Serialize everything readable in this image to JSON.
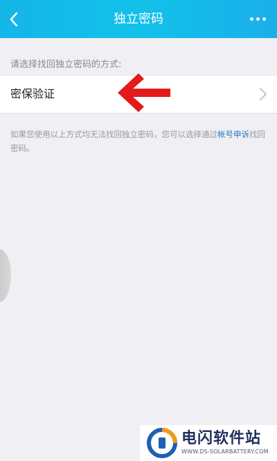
{
  "header": {
    "title": "独立密码",
    "back_icon": "chevron-left-icon",
    "more_icon": "more-horizontal-icon",
    "color": "#15b6e8"
  },
  "prompt_text": "请选择找回独立密码的方式:",
  "options": [
    {
      "label": "密保验证",
      "icon": "chevron-right-icon"
    }
  ],
  "hint": {
    "prefix": "如果您使用以上方式均无法找回独立密码，您可以选择通过",
    "link": "帐号申诉",
    "suffix": "找回密码。"
  },
  "annotation": {
    "icon": "red-arrow-left-icon",
    "color": "#e41a1a"
  },
  "watermark": {
    "name": "电闪软件站",
    "url": "WWW.DS-SOLARBATTERY.COM"
  }
}
